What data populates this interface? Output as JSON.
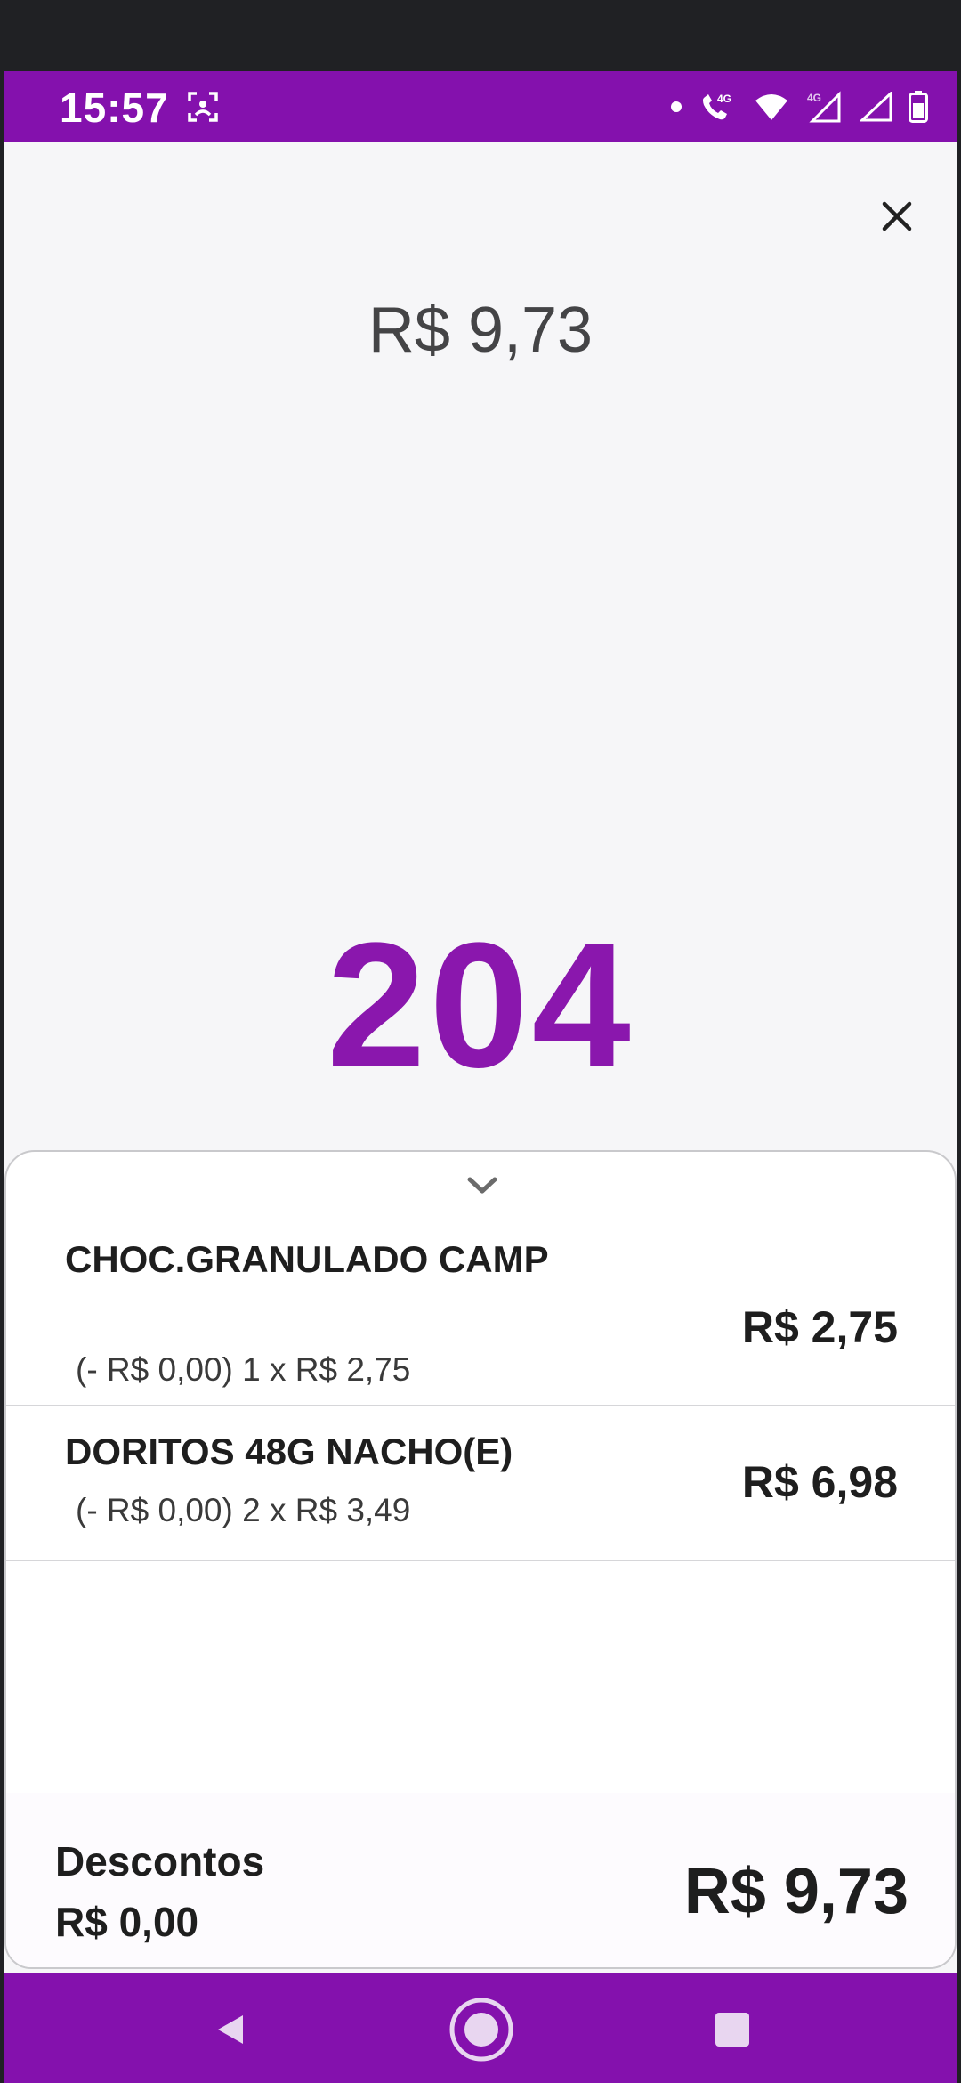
{
  "status_bar": {
    "time": "15:57",
    "icons": [
      "face-scan-icon",
      "dot-icon",
      "wifi-call-4g-icon",
      "wifi-icon",
      "signal-4g-icon",
      "signal-icon",
      "battery-icon"
    ],
    "network_labels": [
      "4G",
      "4G"
    ]
  },
  "header": {
    "amount": "R$ 9,73",
    "close_icon": "close-icon"
  },
  "order": {
    "number": "204"
  },
  "items": [
    {
      "name": "CHOC.GRANULADO CAMP",
      "detail": "(- R$ 0,00) 1 x R$ 2,75",
      "price": "R$ 2,75"
    },
    {
      "name": "DORITOS 48G NACHO(E)",
      "detail": "(- R$ 0,00) 2 x R$ 3,49",
      "price": "R$ 6,98"
    }
  ],
  "summary": {
    "discounts_label": "Descontos",
    "discounts_value": "R$ 0,00",
    "total": "R$ 9,73"
  },
  "nav": {
    "icons": [
      "back-icon",
      "home-icon",
      "recents-icon"
    ]
  },
  "colors": {
    "brand": "#8411ad",
    "order_number": "#8a17ad",
    "background": "#f6f6f8",
    "sheet": "#ffffff"
  }
}
